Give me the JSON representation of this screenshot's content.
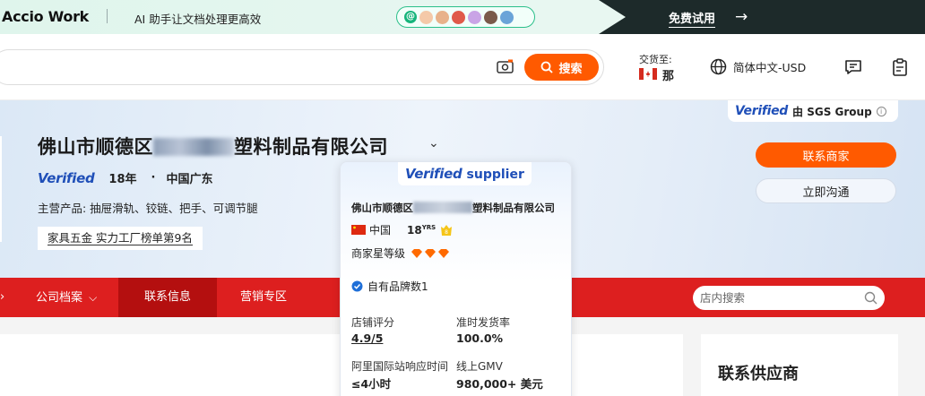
{
  "promo": {
    "logo": "Accio Work",
    "tagline": "AI 助手让文档处理更高效",
    "trial": "免费试用",
    "colors": {
      "accent": "#17b57c",
      "dark": "#1d2a2a"
    }
  },
  "header": {
    "search_button": "搜索",
    "ship_label": "交货至:",
    "ship_dest": "那",
    "language": "简体中文-USD"
  },
  "hero": {
    "company_prefix": "佛山市顺德区",
    "company_suffix": "塑料制品有限公司",
    "verified": "Verified",
    "years": "18年",
    "dot": "·",
    "location": "中国广东",
    "products": "主营产品: 抽屉滑轨、铰链、把手、可调节腿",
    "rank": "家具五金 实力工厂榜单第9名",
    "sgs_verified": "Verified",
    "sgs_by": "由 SGS Group",
    "contact_button": "联系商家",
    "chat_button": "立即沟通"
  },
  "nav": {
    "items": [
      {
        "label": "公司档案"
      },
      {
        "label": "联系信息"
      },
      {
        "label": "营销专区"
      }
    ],
    "search_placeholder": "店内搜索"
  },
  "popover": {
    "verified": "Verified",
    "supplier": "supplier",
    "name_prefix": "佛山市顺德区",
    "name_suffix": "塑料制品有限公司",
    "country": "中国",
    "years": "18",
    "years_unit": "YRS",
    "star_label": "商家星等级",
    "brand": "自有品牌数1",
    "rating_label": "店铺评分",
    "rating": "4.9/5",
    "ontime_label": "准时发货率",
    "ontime": "100.0%",
    "response_label": "阿里国际站响应时间",
    "response": "≤4小时",
    "gmv_label": "线上GMV",
    "gmv": "980,000+ 美元"
  },
  "right_panel": {
    "title": "联系供应商"
  }
}
